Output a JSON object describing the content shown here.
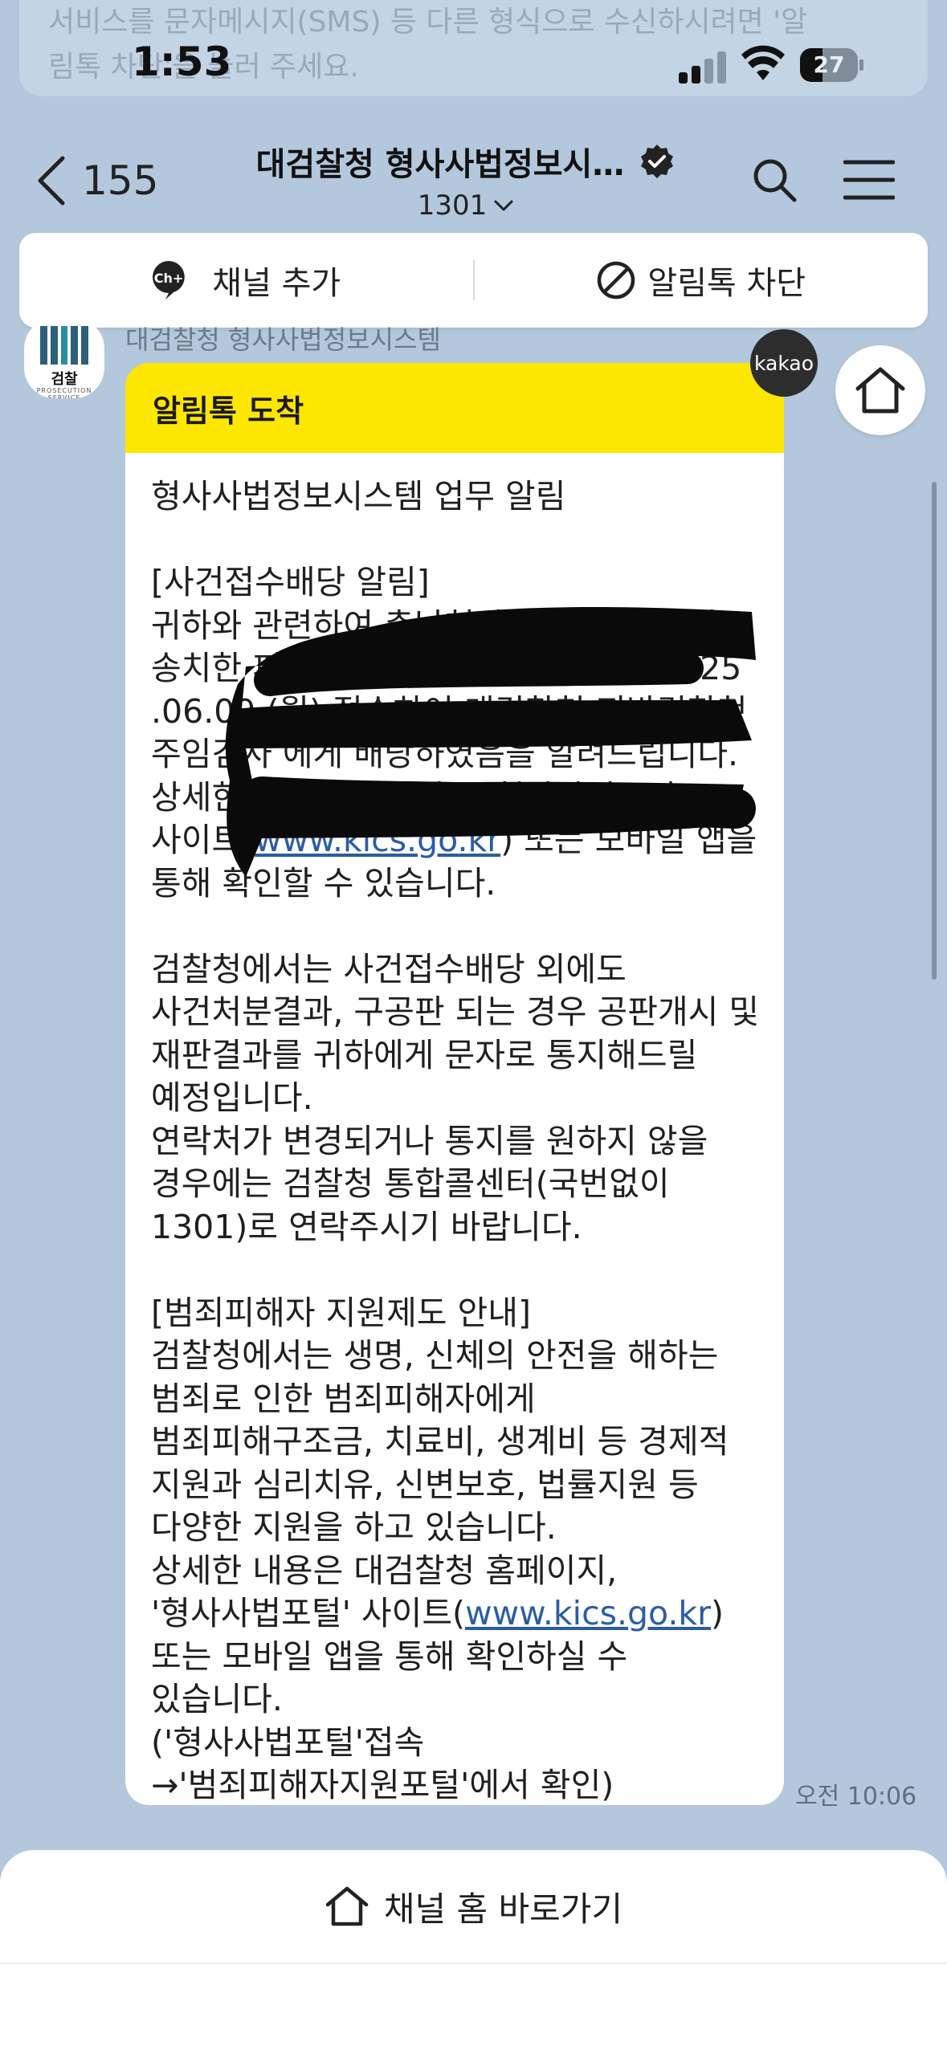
{
  "background_faded_text": [
    "서비스를 문자메시지(SMS) 등 다른 형식으로 수신하시려면 '알",
    "림톡 차단'을 눌러 주세요."
  ],
  "status_bar": {
    "time": "1:53",
    "battery": "27"
  },
  "nav": {
    "back_count": "155",
    "title": "대검찰청 형사사법정보시…",
    "subtitle": "1301"
  },
  "actions": {
    "add_channel": "채널 추가",
    "block_alimtalk": "알림톡 차단",
    "ch_icon_text": "Ch+"
  },
  "sender": {
    "name": "대검찰청 형사사법정보시스템",
    "avatar_text": "검찰",
    "avatar_subtext": "PROSECUTION SERVICE"
  },
  "kakao_badge": "kakao",
  "message": {
    "header": "알림톡 도착",
    "line1": "형사사법정보시스템 업무 알림",
    "section1_title": "[사건접수배당 알림]",
    "para1_before": "귀하와 관련하여 충남천안서북경찰서에서 송치한 피의자 권형철에 대한 사건을 2025 .06.09.(월) 접수하여 대검찰청 지방검찰청 주임검사 에게 배당하였음을 알려드립니다.",
    "para1_mid_a": "상세한 사건진행 내역은 '형사사법포털' 사이트(",
    "link1": "www.kics.go.kr",
    "para1_mid_b": ") 또는 모바일 앱을 통해 확인할 수 있습니다.",
    "para2": "검찰청에서는 사건접수배당 외에도 사건처분결과, 구공판 되는 경우 공판개시 및 재판결과를 귀하에게 문자로 통지해드릴 예정입니다.",
    "para3": "연락처가 변경되거나 통지를 원하지 않을 경우에는 검찰청 통합콜센터(국번없이 1301)로 연락주시기 바랍니다.",
    "section2_title": "[범죄피해자 지원제도 안내]",
    "para4": "검찰청에서는 생명, 신체의 안전을 해하는 범죄로 인한 범죄피해자에게 범죄피해구조금, 치료비, 생계비 등 경제적 지원과 심리치유, 신변보호, 법률지원 등 다양한 지원을 하고 있습니다.",
    "para5_a": "상세한 내용은 대검찰청 홈페이지, '형사사법포털' 사이트(",
    "link2": "www.kics.go.kr",
    "para5_b": ") 또는 모바일 앱을 통해 확인하실 수 있습니다.",
    "para6": "('형사사법포털'접속→'범죄피해자지원포털'에서 확인)",
    "time": "오전 10:06"
  },
  "bottom": {
    "home_shortcut": "채널 홈 바로가기"
  },
  "colors": {
    "background": "#b3c8dd",
    "header_yellow": "#fde602",
    "link_blue": "#2b5ca8"
  }
}
